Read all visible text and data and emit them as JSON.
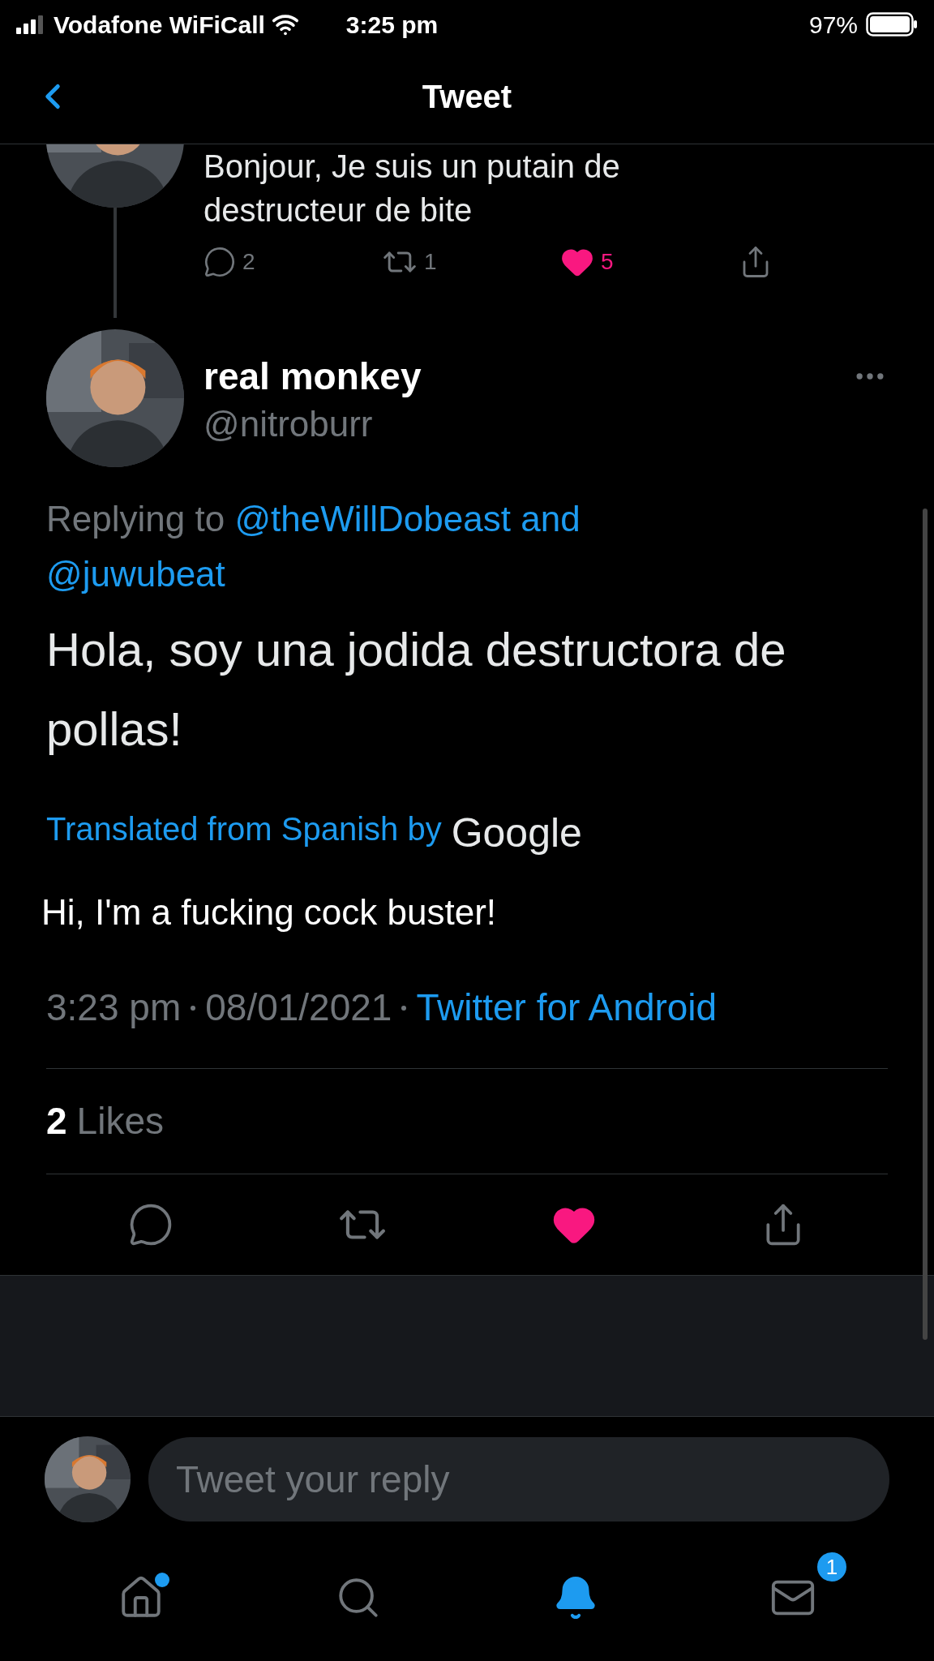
{
  "status_bar": {
    "carrier": "Vodafone WiFiCall",
    "time": "3:25 pm",
    "battery": "97%"
  },
  "header": {
    "title": "Tweet"
  },
  "parent_tweet": {
    "lines": [
      "Bonjour, Je suis un putain de",
      "destructeur de bite"
    ],
    "reply_count": "2",
    "retweet_count": "1",
    "like_count": "5",
    "liked": true
  },
  "tweet": {
    "name": "real monkey",
    "handle": "@nitroburr",
    "replying_prefix": "Replying to",
    "mentions": [
      "@theWillDobeast",
      "@juwubeat"
    ],
    "conjunction": "and",
    "text": "Hola, soy una jodida destructora de pollas!",
    "translation_label": "Translated from Spanish by",
    "translation_brand": "Google",
    "translated_text": "Hi, I'm a fucking cock buster!",
    "time": "3:23 pm",
    "date": "08/01/2021",
    "source": "Twitter for Android",
    "likes_count": "2",
    "likes_label": "Likes",
    "liked": true
  },
  "reply_field": {
    "placeholder": "Tweet your reply"
  },
  "tab_bar": [
    {
      "kind": "home",
      "selected": false,
      "dot": true
    },
    {
      "kind": "search",
      "selected": false,
      "dot": false
    },
    {
      "kind": "notifications",
      "selected": true,
      "dot": false
    },
    {
      "kind": "messages",
      "selected": false,
      "dot": false,
      "badge": "1"
    }
  ]
}
